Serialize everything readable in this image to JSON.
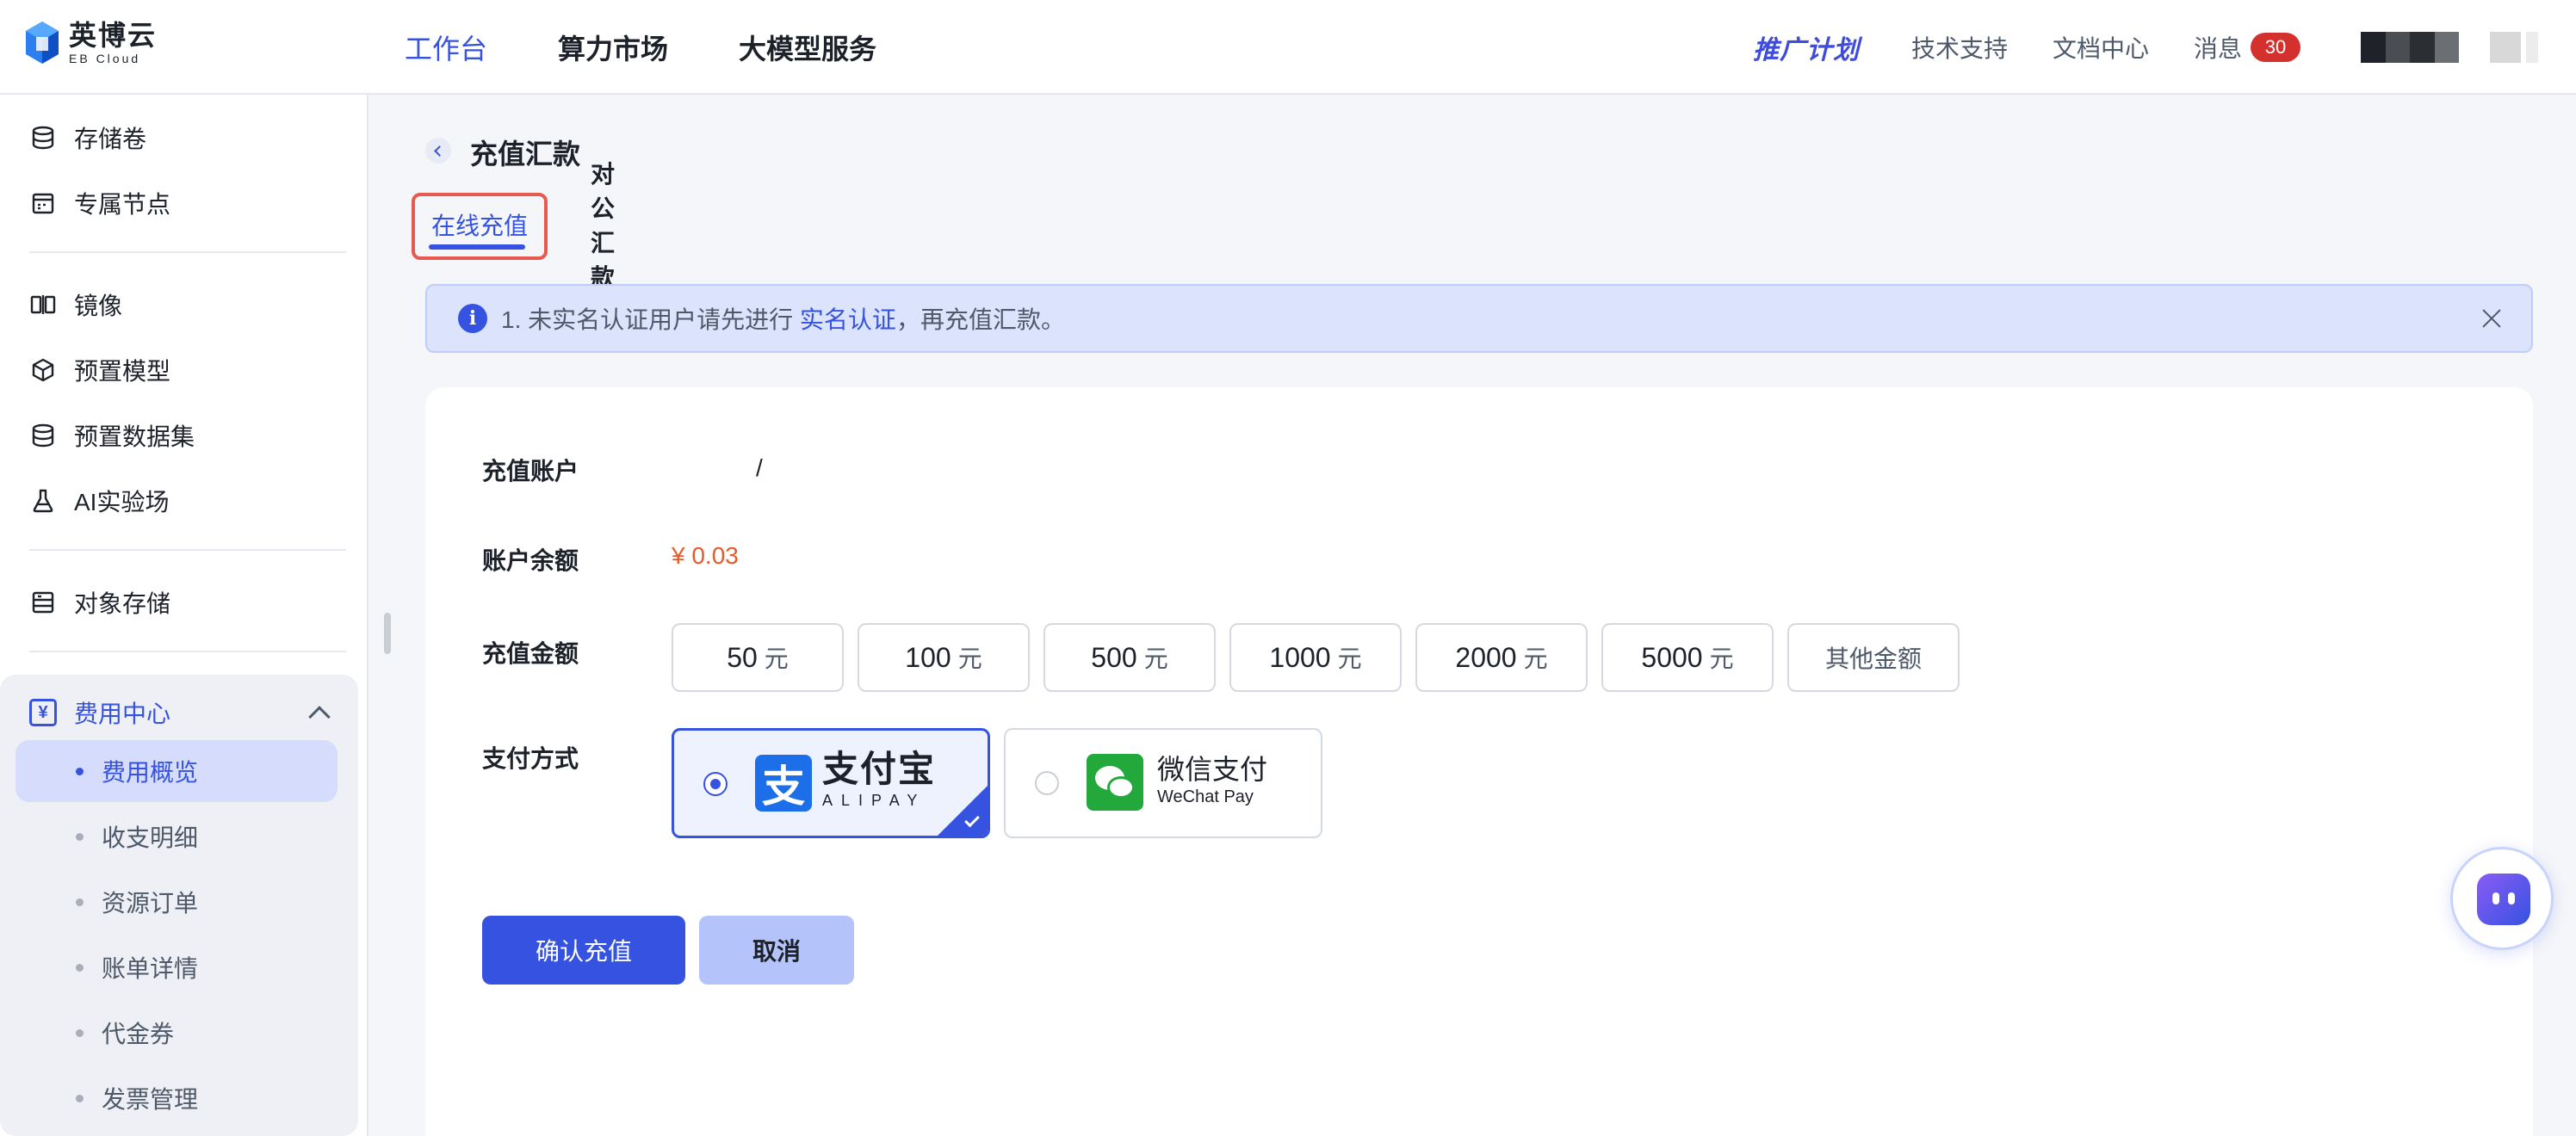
{
  "header": {
    "logo_name": "英博云",
    "logo_sub": "EB Cloud",
    "nav": [
      "工作台",
      "算力市场",
      "大模型服务"
    ],
    "promo": "推广计划",
    "links": [
      "技术支持",
      "文档中心"
    ],
    "messages_label": "消息",
    "messages_count": "30"
  },
  "sidebar": {
    "items": [
      "存储卷",
      "专属节点",
      "镜像",
      "预置模型",
      "预置数据集",
      "AI实验场",
      "对象存储"
    ],
    "fee_center": {
      "label": "费用中心",
      "icon_glyph": "¥",
      "children": [
        "费用概览",
        "收支明细",
        "资源订单",
        "账单详情",
        "代金券",
        "发票管理"
      ],
      "active_child": "费用概览"
    }
  },
  "page": {
    "title": "充值汇款",
    "tabs": [
      "在线充值",
      "对公汇款"
    ],
    "active_tab": "在线充值"
  },
  "notice": {
    "prefix": "1. 未实名认证用户请先进行 ",
    "link": "实名认证",
    "suffix": "，再充值汇款。",
    "info_glyph": "i"
  },
  "form": {
    "account_label": "充值账户",
    "account_value": "/",
    "balance_label": "账户余额",
    "balance_value": "¥ 0.03",
    "amount_label": "充值金额",
    "amounts": [
      {
        "value": "50",
        "unit": "元"
      },
      {
        "value": "100",
        "unit": "元"
      },
      {
        "value": "500",
        "unit": "元"
      },
      {
        "value": "1000",
        "unit": "元"
      },
      {
        "value": "2000",
        "unit": "元"
      },
      {
        "value": "5000",
        "unit": "元"
      }
    ],
    "other_amount": "其他金额",
    "payment_label": "支付方式",
    "alipay": {
      "glyph": "支",
      "name": "支付宝",
      "name_en": "ALIPAY",
      "selected": true
    },
    "wechat": {
      "name": "微信支付",
      "name_en": "WeChat Pay",
      "selected": false
    },
    "confirm": "确认充值",
    "cancel": "取消"
  },
  "colors": {
    "accent": "#3552e0",
    "balance": "#e55b2b",
    "badge": "#d4302d",
    "tab_highlight": "#e65a4f",
    "alipay": "#1d6fe9",
    "wechat": "#23a93b"
  }
}
